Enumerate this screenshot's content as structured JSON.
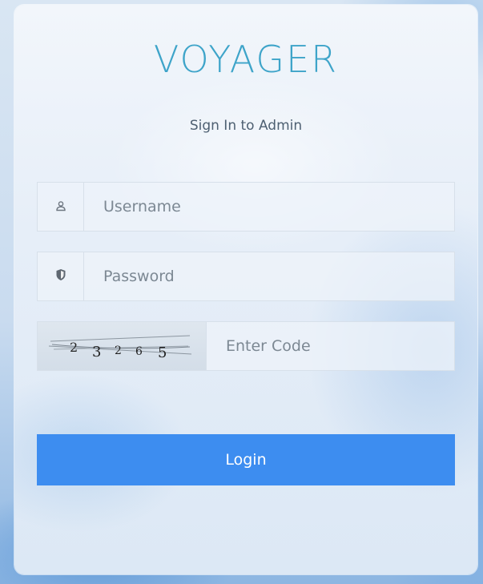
{
  "brand": {
    "logo_text": "VOYAGER"
  },
  "form": {
    "title": "Sign In to Admin",
    "username": {
      "placeholder": "Username",
      "icon": "user-icon"
    },
    "password": {
      "placeholder": "Password",
      "icon": "shield-icon"
    },
    "code": {
      "placeholder": "Enter Code",
      "captcha_digits": [
        "2",
        "3",
        "2",
        "6",
        "5"
      ]
    },
    "login_label": "Login"
  },
  "colors": {
    "accent": "#3d8df0",
    "logo": "#3ea4c9",
    "subtitle": "#4e6072"
  }
}
